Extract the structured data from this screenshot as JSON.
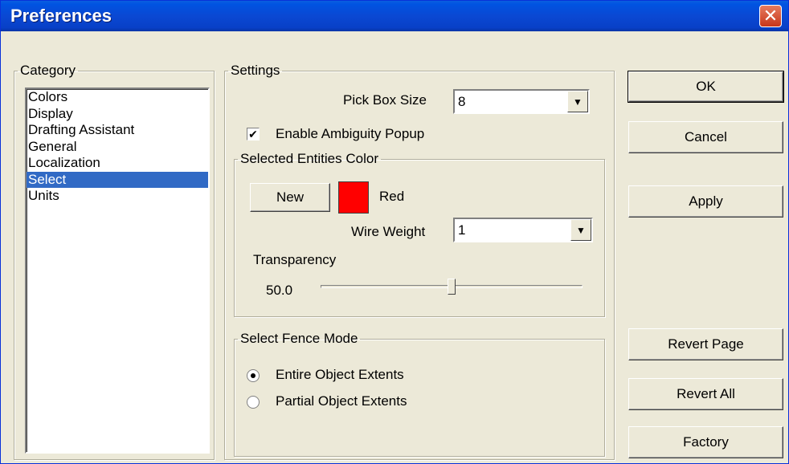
{
  "window": {
    "title": "Preferences",
    "close_glyph": "✕"
  },
  "category": {
    "legend": "Category",
    "items": [
      "Colors",
      "Display",
      "Drafting Assistant",
      "General",
      "Localization",
      "Select",
      "Units"
    ],
    "selected": "Select"
  },
  "settings": {
    "legend": "Settings",
    "pick_box_size": {
      "label": "Pick Box Size",
      "value": "8"
    },
    "ambiguity": {
      "label": "Enable Ambiguity Popup",
      "checked": true,
      "check_glyph": "✔"
    },
    "selected_color": {
      "legend": "Selected Entities Color",
      "new_button": "New",
      "color_name": "Red",
      "color_hex": "#ff0000",
      "wire_weight_label": "Wire Weight",
      "wire_weight_value": "1",
      "transparency_label": "Transparency",
      "transparency_value": "50.0",
      "transparency_fraction": 0.5
    },
    "fence_mode": {
      "legend": "Select Fence Mode",
      "options": [
        "Entire Object Extents",
        "Partial Object Extents"
      ],
      "selected": "Entire Object Extents"
    }
  },
  "buttons": {
    "ok": "OK",
    "cancel": "Cancel",
    "apply": "Apply",
    "revert_page": "Revert Page",
    "revert_all": "Revert All",
    "factory": "Factory"
  },
  "dropdown_glyph": "▼",
  "colors": {
    "selection": "#316ac5",
    "titlebar": "#0a48d3",
    "dialog_bg": "#ece9d8"
  }
}
